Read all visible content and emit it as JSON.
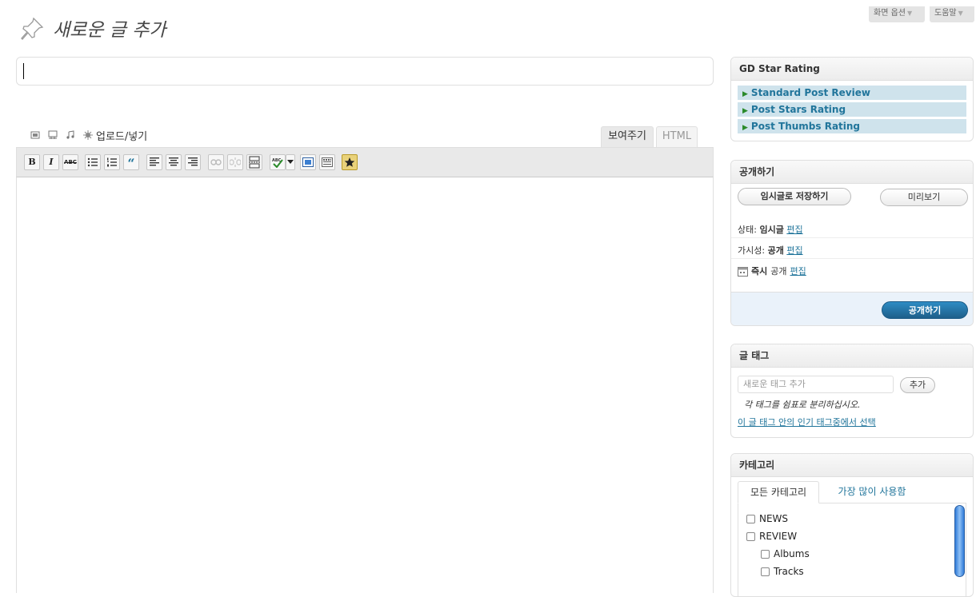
{
  "screen_meta": {
    "screen_options": "화면 옵션",
    "help": "도움말",
    "arrow": "▼"
  },
  "page": {
    "title": "새로운 글 추가",
    "post_title_value": ""
  },
  "media": {
    "upload_insert": "업로드/넣기"
  },
  "editor_tabs": {
    "visual": "보여주기",
    "html": "HTML"
  },
  "toolbar": {
    "bold": "B",
    "italic": "I",
    "strikethrough": "ABC",
    "blockquote": "“"
  },
  "gd_star": {
    "title": "GD Star Rating",
    "items": [
      "Standard Post Review",
      "Post Stars Rating",
      "Post Thumbs Rating"
    ]
  },
  "publish": {
    "title": "공개하기",
    "save_draft": "임시글로 저장하기",
    "preview": "미리보기",
    "status_label": "상태:",
    "status_value": "임시글",
    "visibility_label": "가시성:",
    "visibility_value": "공개",
    "schedule_bold": "즉시",
    "schedule_rest": "공개",
    "edit": "편집",
    "publish_button": "공개하기"
  },
  "tags": {
    "title": "글 태그",
    "input_placeholder": "새로운 태그 추가",
    "add_button": "추가",
    "hint": "각 태그를 쉼표로 분리하십시오.",
    "popular_link": "이 글 태그 안의 인기 태그중에서 선택"
  },
  "categories": {
    "title": "카테고리",
    "tab_all": "모든 카테고리",
    "tab_popular": "가장 많이 사용함",
    "items": [
      "NEWS",
      "REVIEW",
      "Albums",
      "Tracks"
    ]
  },
  "colors": {
    "link_blue": "#21759b",
    "publish_blue": "#2e8cc4",
    "gd_item_bg": "#cfe3ec"
  }
}
